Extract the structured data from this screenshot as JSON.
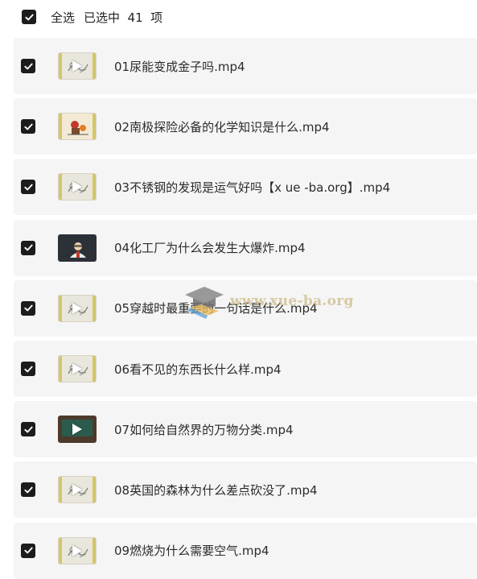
{
  "header": {
    "select_all_label": "全选",
    "selected_info": "已选中  41  项",
    "checked": true
  },
  "files": [
    {
      "name": "01尿能变成金子吗.mp4",
      "checked": true,
      "thumb": "doodle"
    },
    {
      "name": "02南极探险必备的化学知识是什么.mp4",
      "checked": true,
      "thumb": "colorful"
    },
    {
      "name": "03不锈钢的发现是运气好吗【x  ue -ba.org】.mp4",
      "checked": true,
      "thumb": "doodle"
    },
    {
      "name": "04化工厂为什么会发生大爆炸.mp4",
      "checked": true,
      "thumb": "dark"
    },
    {
      "name": "05穿越时最重要的一句话是什么.mp4",
      "checked": true,
      "thumb": "doodle"
    },
    {
      "name": "06看不见的东西长什么样.mp4",
      "checked": true,
      "thumb": "doodle"
    },
    {
      "name": "07如何给自然界的万物分类.mp4",
      "checked": true,
      "thumb": "board"
    },
    {
      "name": "08英国的森林为什么差点砍没了.mp4",
      "checked": true,
      "thumb": "doodle"
    },
    {
      "name": "09燃烧为什么需要空气.mp4",
      "checked": true,
      "thumb": "doodle"
    }
  ],
  "watermark": {
    "text": "www.xue-ba.org"
  },
  "colors": {
    "checkbox": "#1c1c1c",
    "row_bg": "#f5f5f5",
    "thumb_accent": "#d4c66a"
  }
}
